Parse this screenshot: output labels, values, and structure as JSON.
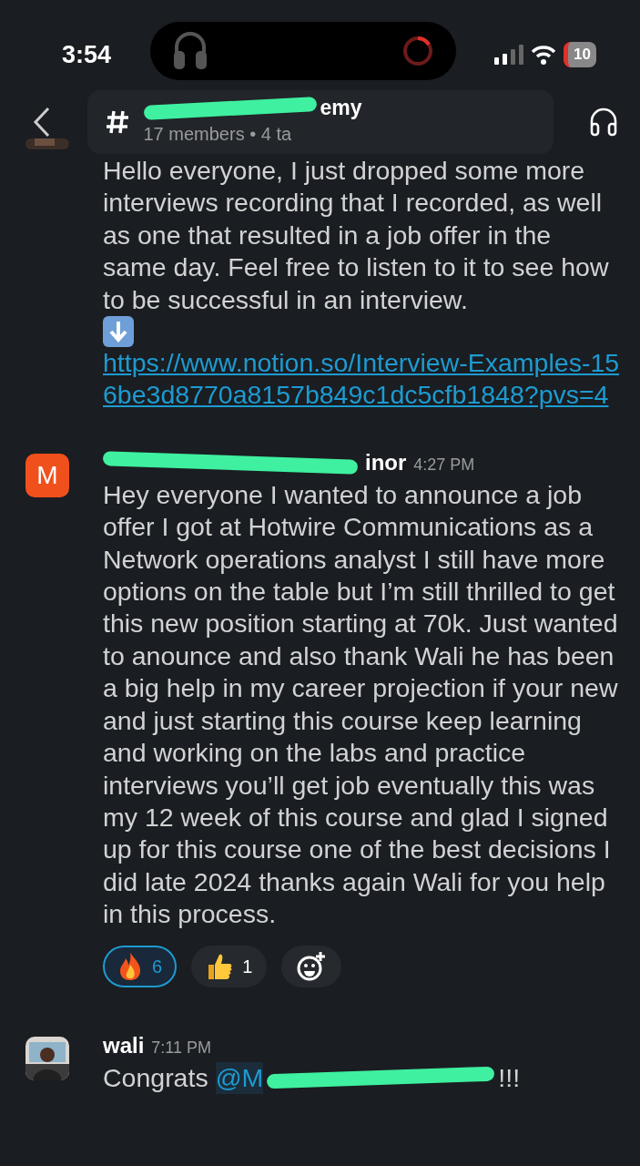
{
  "status_bar": {
    "time": "3:54",
    "battery": "10"
  },
  "header": {
    "channel_visible": "emy",
    "subtitle_visible": "17 members • 4 ta",
    "redacted": true
  },
  "messages": [
    {
      "kind": "continuation",
      "text": "Hello everyone, I just dropped some more interviews recording that I recorded,  as well as one that resulted in a job offer in the same day. Feel free to listen to it  to see how to be successful in an interview.",
      "link": "https://www.notion.so/Interview-Examples-156be3d8770a8157b849c1dc5cfb1848?pvs=4"
    },
    {
      "kind": "initial",
      "initial": "M",
      "author_visible": "inor",
      "redacted": true,
      "time": "4:27 PM",
      "text": "Hey everyone I wanted to announce a job offer I got at Hotwire Communications as a Network operations analyst I still have more options on the table but I’m still thrilled to get this new position starting at 70k. Just wanted to anounce and also thank Wali he has been a big help in my career projection if your new and just starting this course keep learning and working on the labs and practice interviews you’ll get job eventually this was my 12 week of this course and glad I signed up for this course one of the best decisions I did late 2024 thanks again Wali for you help in this process.",
      "reactions": [
        {
          "kind": "fire",
          "count": "6",
          "selected": true
        },
        {
          "kind": "thumbs-up",
          "count": "1",
          "selected": false
        }
      ]
    },
    {
      "author": "wali",
      "time": "7:11 PM",
      "text": "Congrats",
      "mention_visible": "@M",
      "suffix": "!!!",
      "redacted": true
    }
  ]
}
